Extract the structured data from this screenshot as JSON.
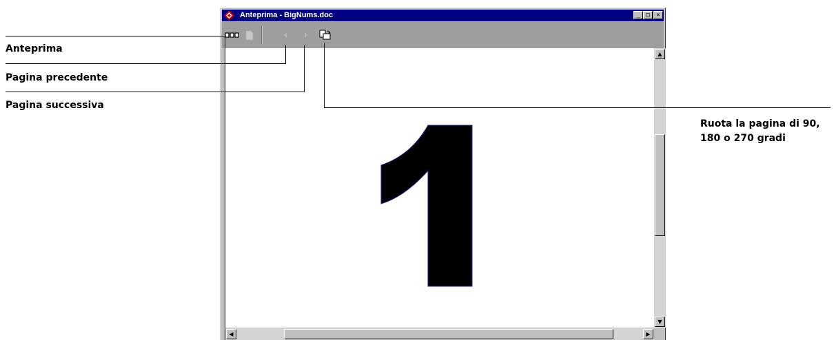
{
  "window": {
    "title": "Anteprima - BigNums.doc",
    "caption_buttons": {
      "minimize": "_",
      "maximize": "□",
      "close": "✕"
    }
  },
  "toolbar": {
    "buttons": [
      {
        "name": "thumbnails",
        "icon": "thumbnails-icon"
      },
      {
        "name": "page",
        "icon": "page-icon"
      },
      {
        "name": "previous",
        "icon": "arrow-left-icon"
      },
      {
        "name": "next",
        "icon": "arrow-right-icon"
      },
      {
        "name": "rotate",
        "icon": "rotate-page-icon"
      }
    ]
  },
  "document": {
    "big_number": "1"
  },
  "callouts": {
    "preview": "Anteprima",
    "previous_page": "Pagina precedente",
    "next_page": "Pagina successiva",
    "rotate_line1": "Ruota la pagina di 90,",
    "rotate_line2": "180 o 270 gradi"
  },
  "colors": {
    "titlebar": "#000080",
    "toolbar": "#9e9e9e",
    "window": "#c0c0c0"
  }
}
